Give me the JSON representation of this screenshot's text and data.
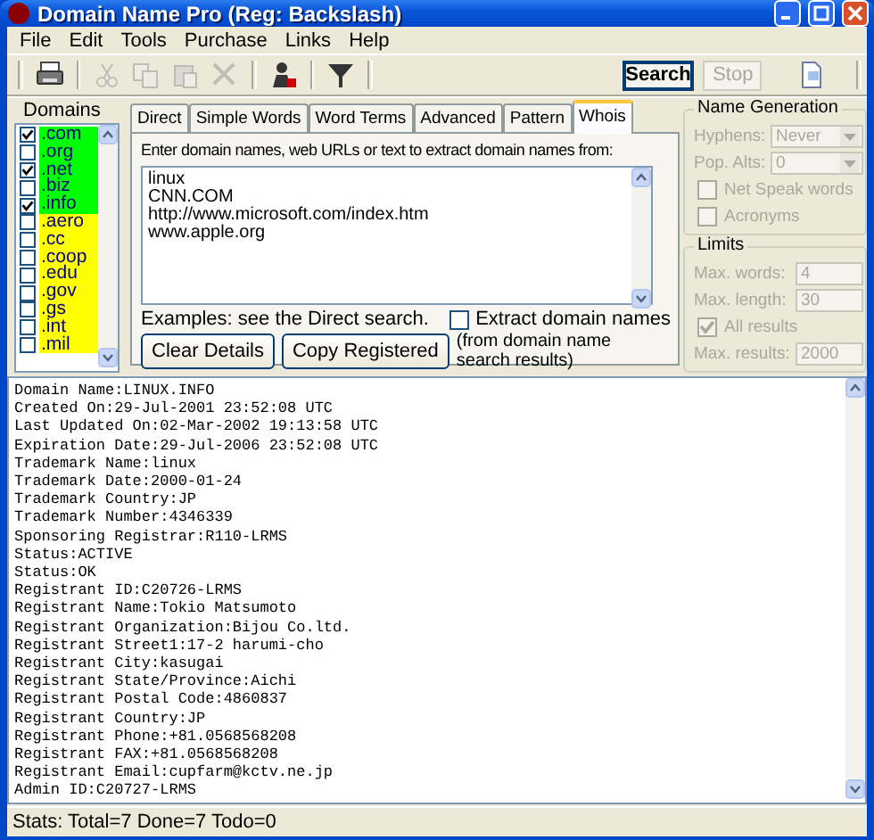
{
  "window": {
    "title": "Domain Name Pro (Reg: Backslash)"
  },
  "menu": [
    "File",
    "Edit",
    "Tools",
    "Purchase",
    "Links",
    "Help"
  ],
  "toolbar": {
    "tools": [
      {
        "kind": "print",
        "disabled": false
      },
      {
        "kind": "sep"
      },
      {
        "kind": "cut",
        "disabled": true
      },
      {
        "kind": "copy",
        "disabled": true
      },
      {
        "kind": "paste",
        "disabled": true
      },
      {
        "kind": "delete",
        "disabled": true
      },
      {
        "kind": "sep"
      },
      {
        "kind": "person",
        "disabled": false
      },
      {
        "kind": "sep"
      },
      {
        "kind": "funnel",
        "disabled": false
      },
      {
        "kind": "sep"
      }
    ],
    "search_button": {
      "label": "Search",
      "disabled": false
    },
    "stop_button": {
      "label": "Stop",
      "disabled": true
    },
    "document_tool": {
      "disabled": false
    }
  },
  "domains": {
    "label": "Domains",
    "items": [
      {
        "label": ".com",
        "checked": true,
        "color": "#00ff00"
      },
      {
        "label": ".org",
        "checked": false,
        "color": "#00ff00"
      },
      {
        "label": ".net",
        "checked": true,
        "color": "#00ff00"
      },
      {
        "label": ".biz",
        "checked": false,
        "color": "#00ff00"
      },
      {
        "label": ".info",
        "checked": true,
        "color": "#00ff00"
      },
      {
        "label": ".aero",
        "checked": false,
        "color": "#ffff00"
      },
      {
        "label": ".cc",
        "checked": false,
        "color": "#ffff00"
      },
      {
        "label": ".coop",
        "checked": false,
        "color": "#ffff00"
      },
      {
        "label": ".edu",
        "checked": false,
        "color": "#ffff00"
      },
      {
        "label": ".gov",
        "checked": false,
        "color": "#ffff00"
      },
      {
        "label": ".gs",
        "checked": false,
        "color": "#ffff00"
      },
      {
        "label": ".int",
        "checked": false,
        "color": "#ffff00"
      },
      {
        "label": ".mil",
        "checked": false,
        "color": "#ffff00"
      }
    ]
  },
  "tabs": [
    {
      "label": "Direct",
      "selected": false
    },
    {
      "label": "Simple Words",
      "selected": false
    },
    {
      "label": "Word Terms",
      "selected": false
    },
    {
      "label": "Advanced",
      "selected": false
    },
    {
      "label": "Pattern",
      "selected": false
    },
    {
      "label": "Whois",
      "selected": true
    }
  ],
  "whois": {
    "prompt": "Enter domain names, web URLs or text to extract domain names from:",
    "input_lines": [
      "linux",
      "CNN.COM",
      "http://www.microsoft.com/index.htm",
      "www.apple.org"
    ],
    "examples": "Examples: see the Direct search.",
    "extract_checkbox": {
      "label": "Extract domain names",
      "checked": false
    },
    "buttons": [
      "Clear Details",
      "Copy Registered"
    ],
    "note": "(from domain name search results)"
  },
  "name_generation": {
    "title": "Name Generation",
    "controls": [
      {
        "kind": "select",
        "label": "Hyphens:",
        "value": "Never",
        "disabled": true
      },
      {
        "kind": "select",
        "label": "Pop. Alts:",
        "value": "0",
        "disabled": true
      },
      {
        "kind": "checkbox",
        "label": "Net Speak words",
        "checked": false,
        "disabled": true
      },
      {
        "kind": "checkbox",
        "label": "Acronyms",
        "checked": false,
        "disabled": true
      }
    ]
  },
  "limits": {
    "title": "Limits",
    "controls": [
      {
        "kind": "input",
        "label": "Max. words:",
        "value": "4",
        "disabled": true
      },
      {
        "kind": "input",
        "label": "Max. length:",
        "value": "30",
        "disabled": true
      },
      {
        "kind": "checkbox",
        "label": "All results",
        "checked": true,
        "disabled": true
      },
      {
        "kind": "input",
        "label": "Max. results:",
        "value": "2000",
        "disabled": true
      }
    ]
  },
  "output": {
    "lines": [
      "Domain Name:LINUX.INFO",
      "Created On:29-Jul-2001 23:52:08 UTC",
      "Last Updated On:02-Mar-2002 19:13:58 UTC",
      "Expiration Date:29-Jul-2006 23:52:08 UTC",
      "Trademark Name:linux",
      "Trademark Date:2000-01-24",
      "Trademark Country:JP",
      "Trademark Number:4346339",
      "Sponsoring Registrar:R110-LRMS",
      "Status:ACTIVE",
      "Status:OK",
      "Registrant ID:C20726-LRMS",
      "Registrant Name:Tokio Matsumoto",
      "Registrant Organization:Bijou Co.ltd.",
      "Registrant Street1:17-2 harumi-cho",
      "Registrant City:kasugai",
      "Registrant State/Province:Aichi",
      "Registrant Postal Code:4860837",
      "Registrant Country:JP",
      "Registrant Phone:+81.0568568208",
      "Registrant FAX:+81.0568568208",
      "Registrant Email:cupfarm@kctv.ne.jp",
      "Admin ID:C20727-LRMS"
    ]
  },
  "status_bar": "Stats: Total=7 Done=7 Todo=0"
}
